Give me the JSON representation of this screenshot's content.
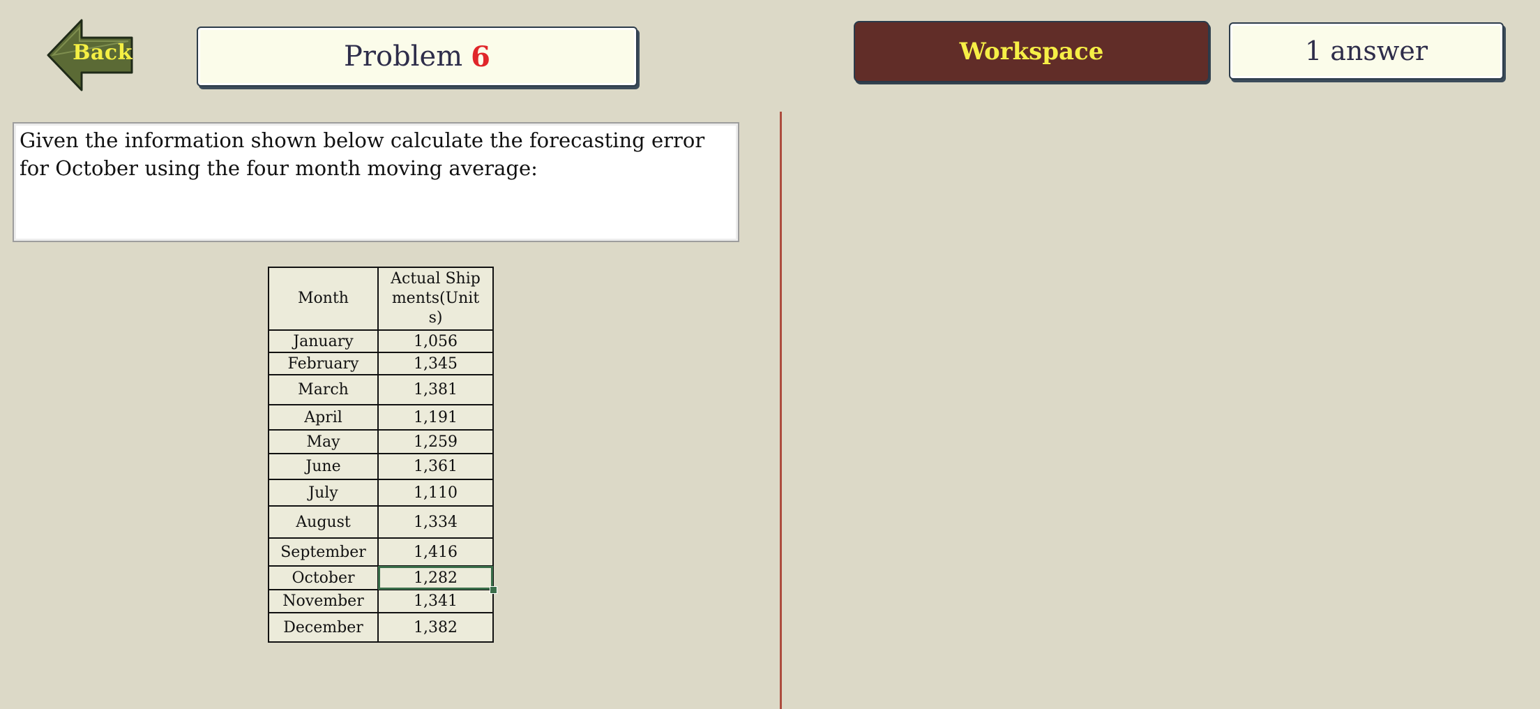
{
  "nav": {
    "back_label": "Back"
  },
  "problem": {
    "label": "Problem",
    "number": "6"
  },
  "workspace": {
    "label": "Workspace"
  },
  "answers": {
    "label": "1 answer"
  },
  "question": {
    "text": "Given the information shown below calculate the forecasting error for October using the four month moving average:"
  },
  "table": {
    "headers": [
      "Month",
      "Actual Shipments(Units)"
    ],
    "rows": [
      {
        "month": "January",
        "shipments": "1,056"
      },
      {
        "month": "February",
        "shipments": "1,345"
      },
      {
        "month": "March",
        "shipments": "1,381"
      },
      {
        "month": "April",
        "shipments": "1,191"
      },
      {
        "month": "May",
        "shipments": "1,259"
      },
      {
        "month": "June",
        "shipments": "1,361"
      },
      {
        "month": "July",
        "shipments": "1,110"
      },
      {
        "month": "August",
        "shipments": "1,334"
      },
      {
        "month": "September",
        "shipments": "1,416"
      },
      {
        "month": "October",
        "shipments": "1,282"
      },
      {
        "month": "November",
        "shipments": "1,341"
      },
      {
        "month": "December",
        "shipments": "1,382"
      }
    ],
    "selected_row": 9
  },
  "colors": {
    "background": "#dcd9c7",
    "back_button": "#5b6a35",
    "button_text": "#f6ef46",
    "workspace_bg": "#612d28",
    "problem_number": "#e0262a",
    "divider": "#ad4c3e",
    "selection": "#3a6e4a"
  }
}
